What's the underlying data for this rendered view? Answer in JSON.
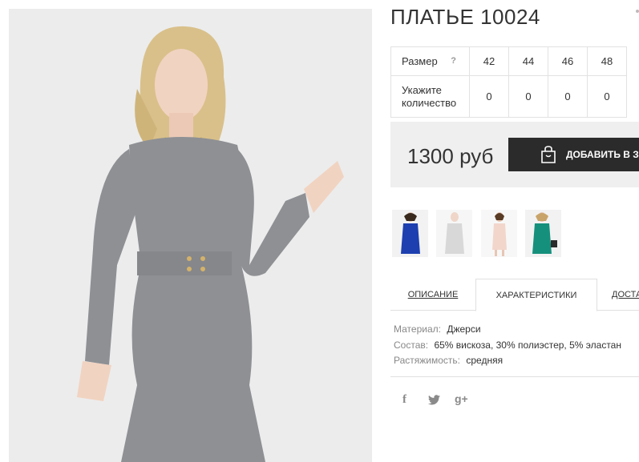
{
  "product": {
    "title": "ПЛАТЬЕ 10024"
  },
  "size_table": {
    "size_label": "Размер",
    "help": "?",
    "sizes": [
      "42",
      "44",
      "46",
      "48"
    ],
    "qty_label_line1": "Укажите",
    "qty_label_line2": "количество",
    "quantities": [
      "0",
      "0",
      "0",
      "0"
    ]
  },
  "price": {
    "value": "1300 руб",
    "add_to_cart": "ДОБАВИТЬ В ЗА"
  },
  "color_variants": [
    {
      "name": "blue",
      "color": "#1d3fb0"
    },
    {
      "name": "light-grey",
      "color": "#d8d8d8"
    },
    {
      "name": "pink",
      "color": "#f2d6cc"
    },
    {
      "name": "teal",
      "color": "#15907c"
    }
  ],
  "tabs": {
    "description": "ОПИСАНИЕ",
    "specs": "ХАРАКТЕРИСТИКИ",
    "delivery": "ДОСТА"
  },
  "specs": [
    {
      "key": "Материал:",
      "value": "Джерси"
    },
    {
      "key": "Состав:",
      "value": "65% вискоза, 30% полиэстер, 5% эластан"
    },
    {
      "key": "Растяжимость:",
      "value": "средняя"
    }
  ],
  "social": {
    "facebook": "f",
    "googleplus": "g+"
  },
  "colors": {
    "button_bg": "#2b2b2b",
    "price_box_bg": "#efefef",
    "dress_grey": "#8e9094"
  }
}
